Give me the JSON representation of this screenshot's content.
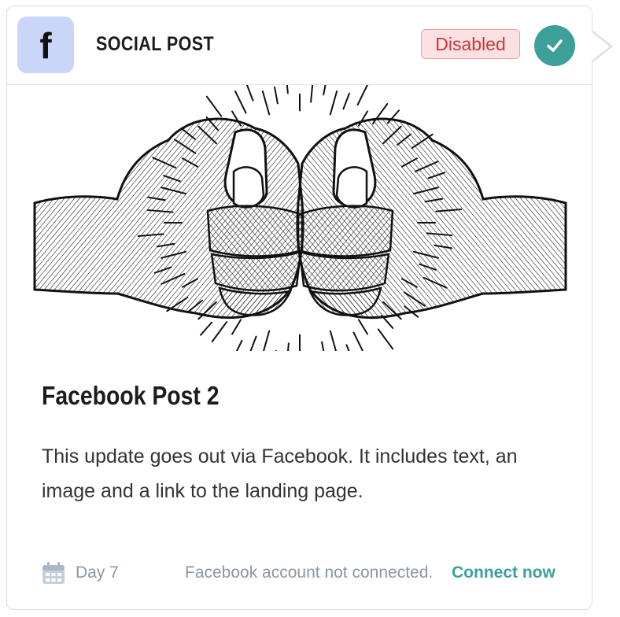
{
  "card": {
    "icon_letter": "f",
    "icon": "facebook-icon",
    "type_label": "SOCIAL POST",
    "status": "Disabled",
    "title": "Facebook Post 2",
    "description": "This update goes out via Facebook. It includes text, an image and a link to the landing page.",
    "image": "fist-bump-illustration"
  },
  "footer": {
    "day": "Day 7",
    "connection_message": "Facebook account not connected.",
    "connect_link": "Connect now"
  },
  "colors": {
    "status_bg": "#fde0e1",
    "status_text": "#c43a3f",
    "accent": "#3d9f99",
    "icon_bg": "#c9d6f7"
  }
}
